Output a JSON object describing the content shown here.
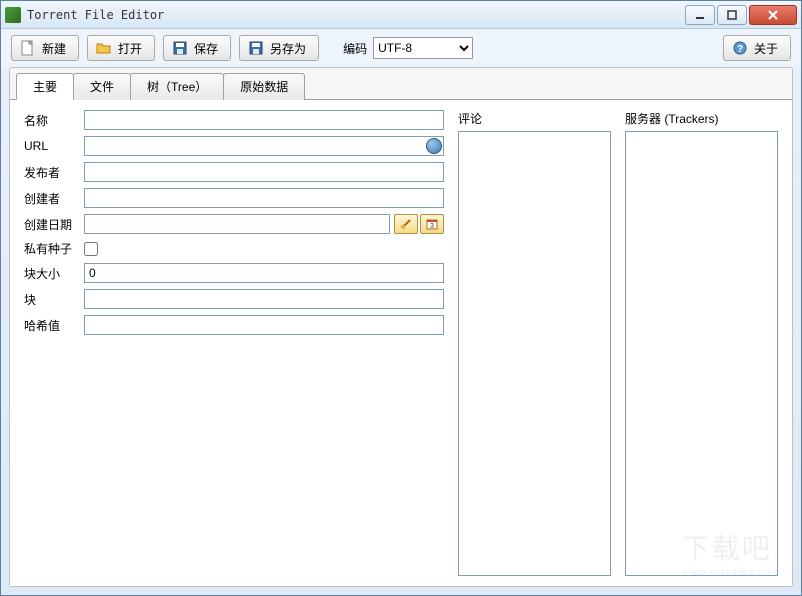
{
  "window": {
    "title": "Torrent File Editor"
  },
  "toolbar": {
    "new_label": "新建",
    "open_label": "打开",
    "save_label": "保存",
    "saveas_label": "另存为",
    "encoding_label": "编码",
    "encoding_value": "UTF-8",
    "about_label": "关于"
  },
  "tabs": {
    "main": "主要",
    "files": "文件",
    "tree": "树（Tree）",
    "raw": "原始数据"
  },
  "form": {
    "name_label": "名称",
    "name_value": "",
    "url_label": "URL",
    "url_value": "",
    "publisher_label": "发布者",
    "publisher_value": "",
    "creator_label": "创建者",
    "creator_value": "",
    "created_label": "创建日期",
    "created_value": "",
    "private_label": "私有种子",
    "private_checked": false,
    "piece_size_label": "块大小",
    "piece_size_value": "0",
    "pieces_label": "块",
    "pieces_value": "",
    "hash_label": "哈希值",
    "hash_value": ""
  },
  "columns": {
    "comment_label": "评论",
    "comment_value": "",
    "trackers_label": "服务器 (Trackers)",
    "trackers_value": ""
  },
  "watermark": {
    "main": "下载吧",
    "sub": "www.xiazaiba.com"
  }
}
